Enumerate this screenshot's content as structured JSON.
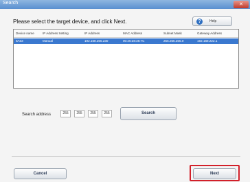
{
  "window": {
    "title": "Search",
    "close_label": "✕"
  },
  "instruction": "Please select the target device, and click Next.",
  "help_button": {
    "icon_glyph": "?",
    "label": "Help"
  },
  "device_table": {
    "headers": [
      "Device name",
      "IP Address Setting",
      "IP Address",
      "MAC Address",
      "Subnet Mask",
      "Gateway Address"
    ],
    "rows": [
      {
        "device_name": "8A03",
        "ip_setting": "Manual",
        "ip_address": "192.168.255.230",
        "mac_address": "00:26:38:36:7C",
        "subnet_mask": "255.255.255.0",
        "gateway": "192.168.222.1",
        "selected": true
      }
    ]
  },
  "search": {
    "label": "Search address",
    "octets": [
      "255",
      "255",
      "255",
      "255"
    ],
    "button_label": "Search"
  },
  "footer": {
    "cancel_label": "Cancel",
    "next_label": "Next",
    "next_highlighted": true
  },
  "colors": {
    "selected_row": "#3a78cf",
    "highlight": "#d2202a"
  }
}
